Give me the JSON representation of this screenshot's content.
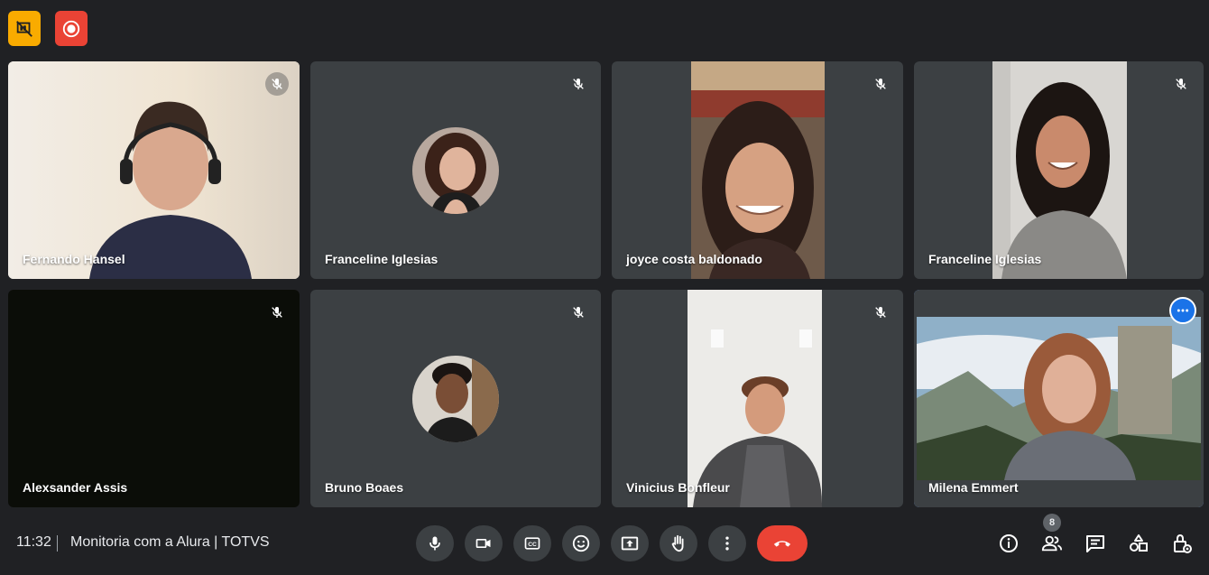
{
  "top_buttons": [
    {
      "name": "presentation-off-icon",
      "color": "#f9ab00"
    },
    {
      "name": "recording-icon",
      "color": "#ea4335"
    }
  ],
  "participants": [
    {
      "name": "Fernando Hansel"
    },
    {
      "name": "Franceline Iglesias"
    },
    {
      "name": "joyce costa baldonado"
    },
    {
      "name": "Franceline Iglesias"
    },
    {
      "name": "Alexsander Assis"
    },
    {
      "name": "Bruno Boaes"
    },
    {
      "name": "Vinicius Bonfleur"
    },
    {
      "name": "Milena Emmert"
    }
  ],
  "bottom_bar": {
    "time": "11:32",
    "meeting_title": "Monitoria com a Alura | TOTVS",
    "controls": [
      "microphone-icon",
      "camera-icon",
      "captions-icon",
      "emoji-icon",
      "present-icon",
      "raise-hand-icon",
      "more-options-icon",
      "end-call-icon"
    ],
    "right_icons": [
      "info-icon",
      "people-icon",
      "chat-icon",
      "activities-icon",
      "host-controls-icon"
    ],
    "participant_count": "8"
  },
  "colors": {
    "background": "#202124",
    "tile": "#3c4043",
    "accent_blue": "#669df6",
    "end_call_red": "#ea4335"
  }
}
